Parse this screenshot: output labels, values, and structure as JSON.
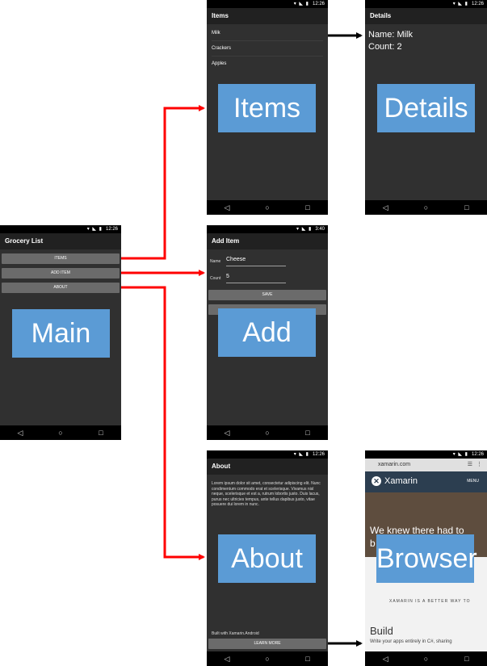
{
  "colors": {
    "red_arrow": "#ff0000",
    "black_arrow": "#000000",
    "label_box": "#5b9bd5"
  },
  "status_time": "12:26",
  "status_time_add": "3:40",
  "nav": {
    "back": "◁",
    "home": "○",
    "recents": "□"
  },
  "main": {
    "title": "Grocery List",
    "buttons": [
      "ITEMS",
      "ADD ITEM",
      "ABOUT"
    ],
    "label": "Main"
  },
  "items": {
    "title": "Items",
    "list": [
      "Milk",
      "Crackers",
      "Apples"
    ],
    "label": "Items"
  },
  "details": {
    "title": "Details",
    "name_line": "Name: Milk",
    "count_line": "Count: 2",
    "label": "Details"
  },
  "add": {
    "title": "Add Item",
    "name_label": "Name",
    "name_value": "Cheese",
    "count_label": "Count",
    "count_value": "5",
    "save_label": "SAVE",
    "label": "Add"
  },
  "about": {
    "title": "About",
    "body": "Lorem ipsum dolor sit amet, consectetur adipiscing elit. Nunc condimentum commodo erat et scelerisque. Vivamus nisl neque, scelerisque et est a, rutrum lobortis justo. Duis lacus, purus nec ultricies tempus, ante tellus dapibus justo, vitae posuere dui lorem in nunc.",
    "footer": "Built with Xamarin.Android",
    "learn_more": "LEARN MORE",
    "label": "About"
  },
  "browser": {
    "url": "xamarin.com",
    "brand": "Xamarin",
    "menu": "MENU",
    "hero_text_1": "We knew there had to",
    "hero_text_2": "b",
    "tagline": "XAMARIN IS A BETTER WAY TO",
    "build": "Build",
    "sub": "Write your apps entirely in C#, sharing",
    "label": "Browser"
  }
}
